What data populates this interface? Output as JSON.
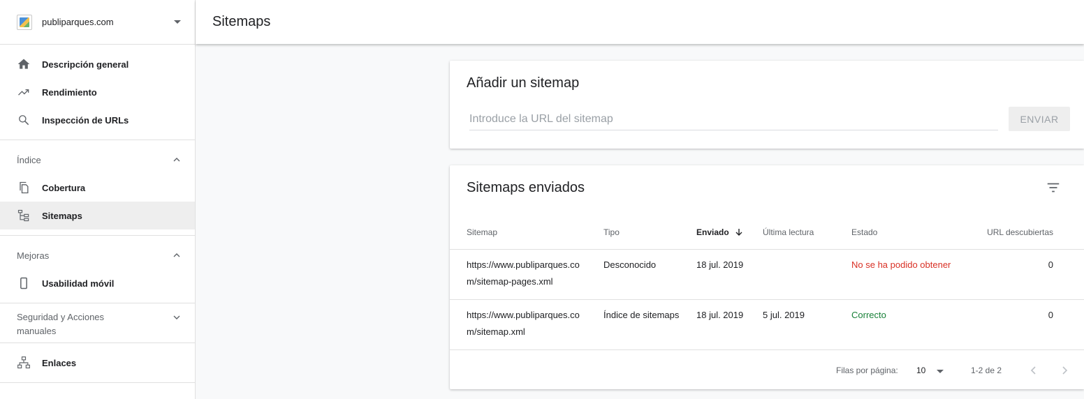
{
  "property": {
    "name": "publiparques.com",
    "icon": "site-favicon"
  },
  "nav": {
    "main": [
      {
        "label": "Descripción general",
        "icon": "home-icon"
      },
      {
        "label": "Rendimiento",
        "icon": "trending-up-icon"
      },
      {
        "label": "Inspección de URLs",
        "icon": "search-icon"
      }
    ],
    "index": {
      "title": "Índice",
      "items": [
        {
          "label": "Cobertura",
          "icon": "copy-icon"
        },
        {
          "label": "Sitemaps",
          "icon": "sitemap-icon",
          "active": true
        }
      ]
    },
    "improvements": {
      "title": "Mejoras",
      "items": [
        {
          "label": "Usabilidad móvil",
          "icon": "phone-icon"
        }
      ]
    },
    "security": {
      "title": "Seguridad y Acciones manuales"
    },
    "links": {
      "label": "Enlaces",
      "icon": "network-icon"
    }
  },
  "header": {
    "title": "Sitemaps"
  },
  "add_card": {
    "title": "Añadir un sitemap",
    "placeholder": "Introduce la URL del sitemap",
    "submit_label": "ENVIAR"
  },
  "submitted": {
    "title": "Sitemaps enviados",
    "columns": [
      "Sitemap",
      "Tipo",
      "Enviado",
      "Última lectura",
      "Estado",
      "URL descubiertas"
    ],
    "sorted_column": "Enviado",
    "rows": [
      {
        "sitemap": "https://www.publiparques.com/sitemap-pages.xml",
        "type": "Desconocido",
        "submitted": "18 jul. 2019",
        "last_read": "",
        "status": "No se ha podido obtener",
        "status_color": "#d93025",
        "urls": "0"
      },
      {
        "sitemap": "https://www.publiparques.com/sitemap.xml",
        "type": "Índice de sitemaps",
        "submitted": "18 jul. 2019",
        "last_read": "5 jul. 2019",
        "status": "Correcto",
        "status_color": "#188038",
        "urls": "0"
      }
    ],
    "pagination": {
      "rows_label": "Filas por página:",
      "rows_per_page": "10",
      "range": "1-2 de 2"
    }
  }
}
